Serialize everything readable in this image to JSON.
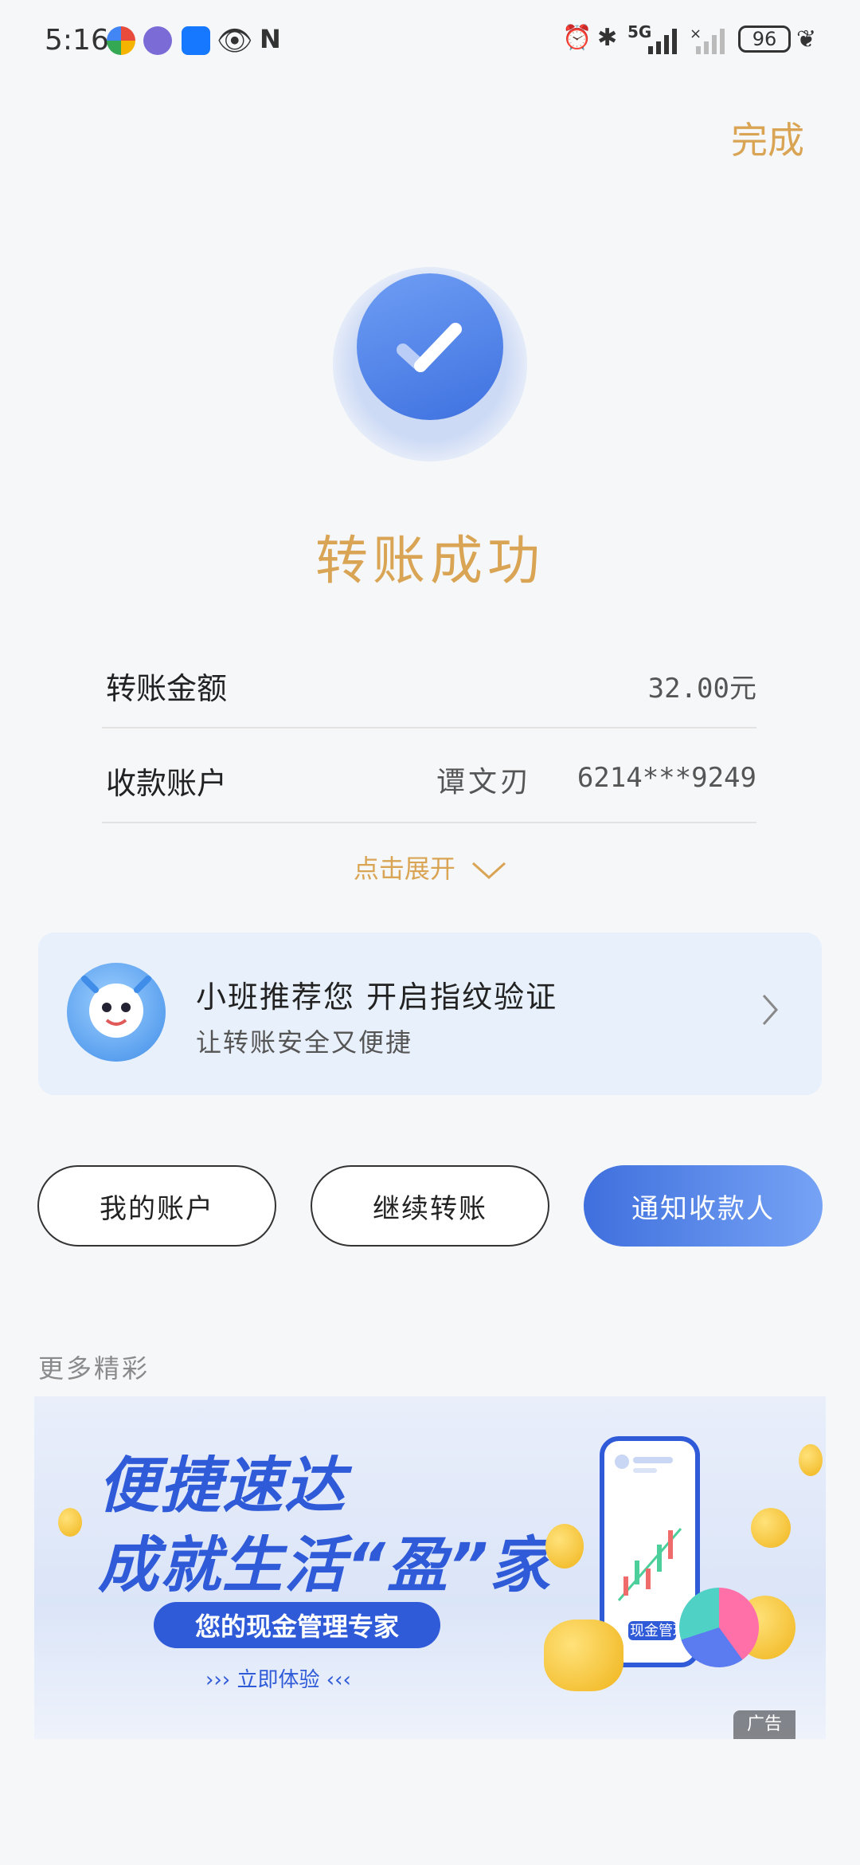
{
  "status_bar": {
    "time": "5:16",
    "battery": "96",
    "network": "5G"
  },
  "header": {
    "done_label": "完成"
  },
  "result": {
    "title": "转账成功"
  },
  "details": {
    "amount_label": "转账金额",
    "amount_value": "32.00元",
    "payee_label": "收款账户",
    "payee_name": "谭文刃",
    "payee_account": "6214***9249",
    "expand_label": "点击展开"
  },
  "promo": {
    "title": "小班推荐您  开启指纹验证",
    "subtitle": "让转账安全又便捷"
  },
  "actions": {
    "my_account": "我的账户",
    "continue_transfer": "继续转账",
    "notify_payee": "通知收款人"
  },
  "more": {
    "label": "更多精彩"
  },
  "banner": {
    "line1": "便捷速达",
    "line2": "成就生活“盈”家",
    "pill": "您的现金管理专家",
    "cta": "››› 立即体验 ‹‹‹",
    "ad_tag": "广告",
    "phone_tag": "现金管理"
  },
  "colors": {
    "accent_gold": "#d9a555",
    "primary_blue": "#3f6fdd"
  }
}
